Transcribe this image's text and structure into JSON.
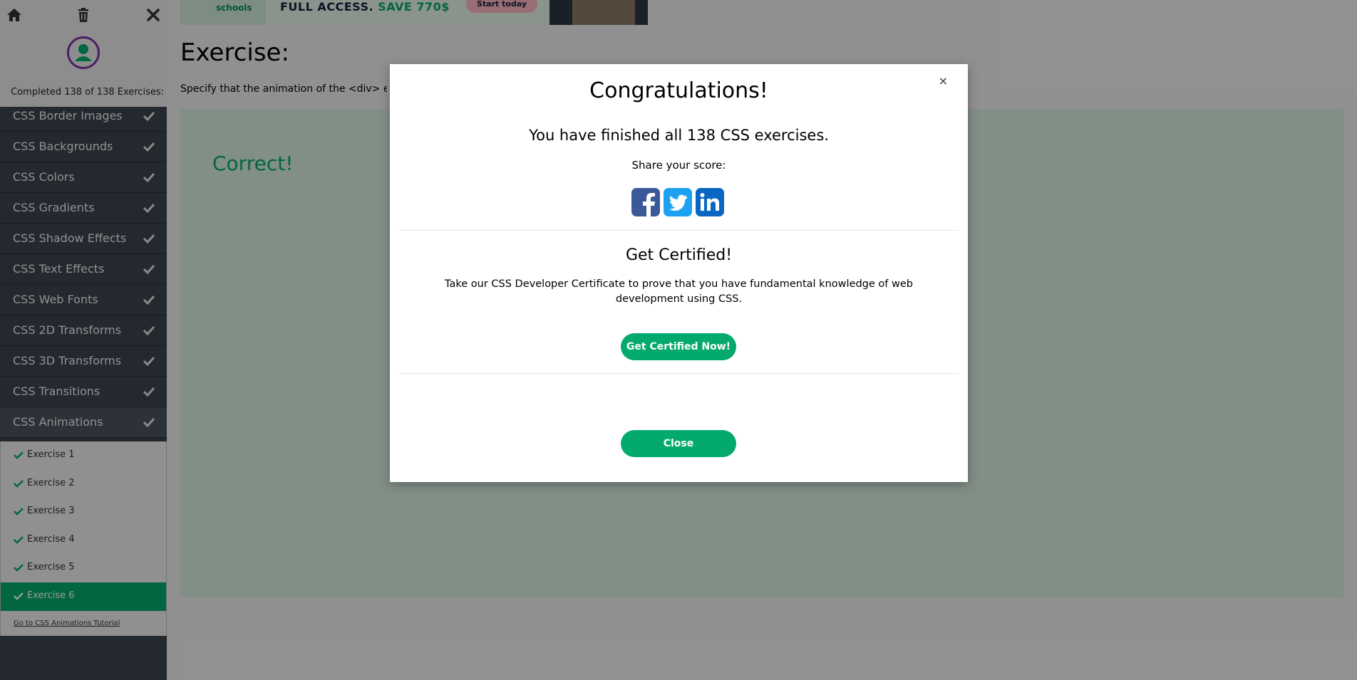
{
  "sidebar": {
    "completed_text": "Completed 138 of 138 Exercises:",
    "topics": [
      {
        "label": "CSS Border Images"
      },
      {
        "label": "CSS Backgrounds"
      },
      {
        "label": "CSS Colors"
      },
      {
        "label": "CSS Gradients"
      },
      {
        "label": "CSS Shadow Effects"
      },
      {
        "label": "CSS Text Effects"
      },
      {
        "label": "CSS Web Fonts"
      },
      {
        "label": "CSS 2D Transforms"
      },
      {
        "label": "CSS 3D Transforms"
      },
      {
        "label": "CSS Transitions"
      },
      {
        "label": "CSS Animations"
      }
    ],
    "exercises": [
      {
        "label": "Exercise 1"
      },
      {
        "label": "Exercise 2"
      },
      {
        "label": "Exercise 3"
      },
      {
        "label": "Exercise 4"
      },
      {
        "label": "Exercise 5"
      },
      {
        "label": "Exercise 6"
      }
    ],
    "tutorial_link": "Go to CSS Animations Tutorial"
  },
  "ad": {
    "schools": "schools",
    "access": "FULL ACCESS.",
    "save": "SAVE 770$",
    "start": "Start today"
  },
  "main": {
    "title": "Exercise:",
    "description": "Specify that the animation of the <div> ele",
    "correct": "Correct!"
  },
  "modal": {
    "close_x": "×",
    "title": "Congratulations!",
    "finished": "You have finished all 138 CSS exercises.",
    "share": "Share your score:",
    "certified_title": "Get Certified!",
    "certified_desc": "Take our CSS Developer Certificate to prove that you have fundamental knowledge of web development using CSS.",
    "certify_button": "Get Certified Now!",
    "close_button": "Close"
  },
  "colors": {
    "accent": "#04aa6d",
    "sidebar_bg": "#3c444f",
    "avatar_ring": "#7e34a8",
    "facebook": "#3b5998",
    "twitter": "#1da1f2",
    "linkedin": "#0a66c2"
  }
}
